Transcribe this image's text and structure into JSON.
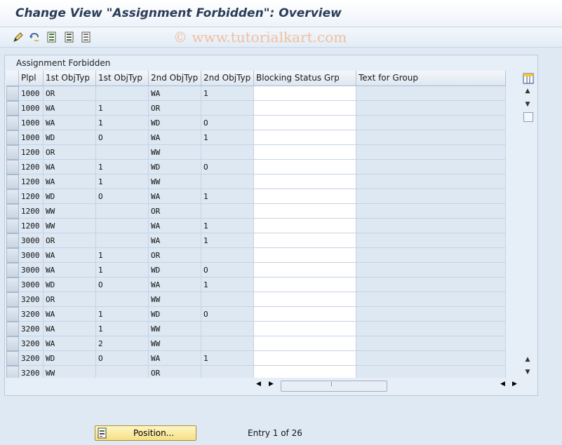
{
  "window": {
    "title": "Change View \"Assignment Forbidden\": Overview",
    "watermark": "© www.tutorialkart.com"
  },
  "toolbar": {
    "icons": [
      "change-display-icon",
      "undo-icon",
      "select-all-icon",
      "select-block-icon",
      "deselect-all-icon"
    ]
  },
  "panel": {
    "title": "Assignment Forbidden"
  },
  "table": {
    "headers": [
      "Plpl",
      "1st ObjTyp",
      "1st ObjTyp",
      "2nd ObjTyp",
      "2nd ObjTyp",
      "Blocking Status Grp",
      "Text for Group"
    ],
    "rows": [
      [
        "1000",
        "OR",
        "",
        "WA",
        "1",
        "",
        ""
      ],
      [
        "1000",
        "WA",
        "1",
        "OR",
        "",
        "",
        ""
      ],
      [
        "1000",
        "WA",
        "1",
        "WD",
        "O",
        "",
        ""
      ],
      [
        "1000",
        "WD",
        "O",
        "WA",
        "1",
        "",
        ""
      ],
      [
        "1200",
        "OR",
        "",
        "WW",
        "",
        "",
        ""
      ],
      [
        "1200",
        "WA",
        "1",
        "WD",
        "O",
        "",
        ""
      ],
      [
        "1200",
        "WA",
        "1",
        "WW",
        "",
        "",
        ""
      ],
      [
        "1200",
        "WD",
        "O",
        "WA",
        "1",
        "",
        ""
      ],
      [
        "1200",
        "WW",
        "",
        "OR",
        "",
        "",
        ""
      ],
      [
        "1200",
        "WW",
        "",
        "WA",
        "1",
        "",
        ""
      ],
      [
        "3000",
        "OR",
        "",
        "WA",
        "1",
        "",
        ""
      ],
      [
        "3000",
        "WA",
        "1",
        "OR",
        "",
        "",
        ""
      ],
      [
        "3000",
        "WA",
        "1",
        "WD",
        "O",
        "",
        ""
      ],
      [
        "3000",
        "WD",
        "O",
        "WA",
        "1",
        "",
        ""
      ],
      [
        "3200",
        "OR",
        "",
        "WW",
        "",
        "",
        ""
      ],
      [
        "3200",
        "WA",
        "1",
        "WD",
        "O",
        "",
        ""
      ],
      [
        "3200",
        "WA",
        "1",
        "WW",
        "",
        "",
        ""
      ],
      [
        "3200",
        "WA",
        "2",
        "WW",
        "",
        "",
        ""
      ],
      [
        "3200",
        "WD",
        "O",
        "WA",
        "1",
        "",
        ""
      ],
      [
        "3200",
        "WW",
        "",
        "OR",
        "",
        "",
        ""
      ]
    ]
  },
  "footer": {
    "position_label": "Position...",
    "entry_text": "Entry 1 of 26"
  }
}
